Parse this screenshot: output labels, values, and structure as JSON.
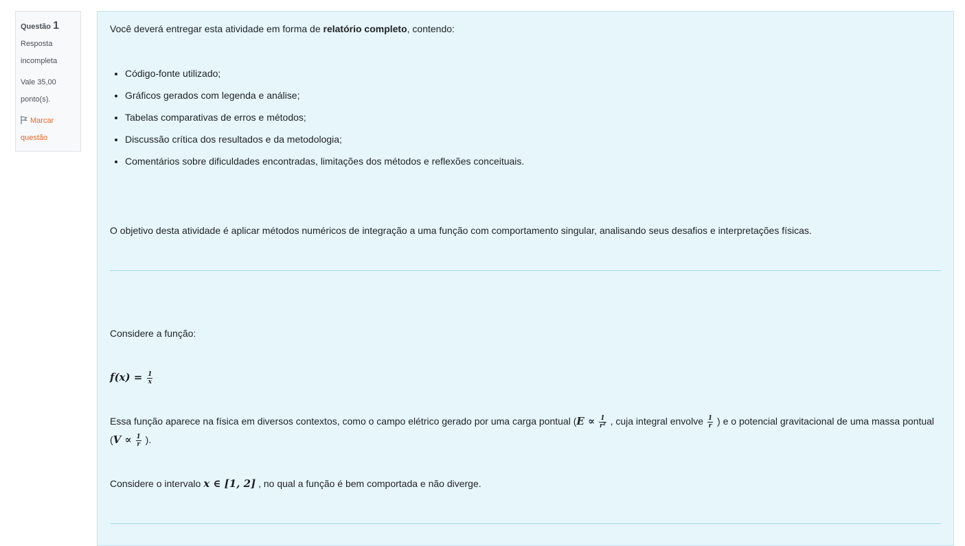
{
  "question": {
    "label": "Questão",
    "number": "1",
    "status": "Resposta incompleta",
    "points": "Vale 35,00 ponto(s).",
    "flag_label": "Marcar questão"
  },
  "intro": {
    "before": "Você deverá entregar esta atividade em forma de ",
    "bold": "relatório completo",
    "after": ", contendo:"
  },
  "requirements": [
    "Código-fonte utilizado;",
    "Gráficos gerados com legenda e análise;",
    "Tabelas comparativas de erros e métodos;",
    "Discussão crítica dos resultados e da metodologia;",
    "Comentários sobre dificuldades encontradas, limitações dos métodos e reflexões conceituais."
  ],
  "objective": "O objetivo desta atividade é aplicar métodos numéricos de integração a uma função com comportamento singular, analisando seus desafios e interpretações físicas.",
  "consider_label": "Considere a função:",
  "formula": {
    "lhs": "f(x) =",
    "num": "1",
    "den": "x"
  },
  "physics": {
    "t1": "Essa função aparece na física em diversos contextos, como o campo elétrico gerado por uma carga pontual (",
    "m1": "E ∝",
    "f1_num": "1",
    "f1_den": "r²",
    "t2": " , cuja integral envolve ",
    "f2_num": "1",
    "f2_den": "r",
    "t3": " ) e o potencial gravitacional de uma massa pontual (",
    "m2": "V ∝",
    "f3_num": "1",
    "f3_den": "r",
    "t4": " )."
  },
  "interval": {
    "before": "Considere o intervalo ",
    "math": "x ∈ [1, 2]",
    "after": " , no qual a função é bem comportada e não diverge."
  }
}
